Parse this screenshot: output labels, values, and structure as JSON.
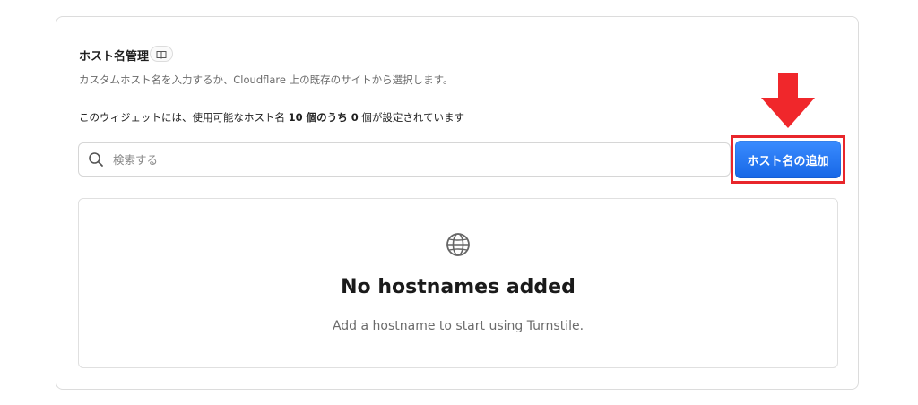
{
  "section": {
    "title": "ホスト名管理",
    "doc_icon": "book-open-icon",
    "description": "カスタムホスト名を入力するか、Cloudflare 上の既存のサイトから選択します。",
    "usage_prefix": "このウィジェットには、使用可能なホスト名 ",
    "usage_total": "10 個",
    "usage_middle": "のうち ",
    "usage_used": "0",
    "usage_suffix": " 個が設定されています"
  },
  "search": {
    "placeholder": "検索する",
    "icon": "search-icon"
  },
  "add_button": {
    "label": "ホスト名の追加"
  },
  "empty_state": {
    "icon": "globe-icon",
    "title": "No hostnames added",
    "subtitle": "Add a hostname to start using Turnstile."
  },
  "annotation": {
    "arrow_color": "#f0272b",
    "highlight_color": "#e8262b"
  },
  "colors": {
    "primary_button": "#1767e6"
  }
}
